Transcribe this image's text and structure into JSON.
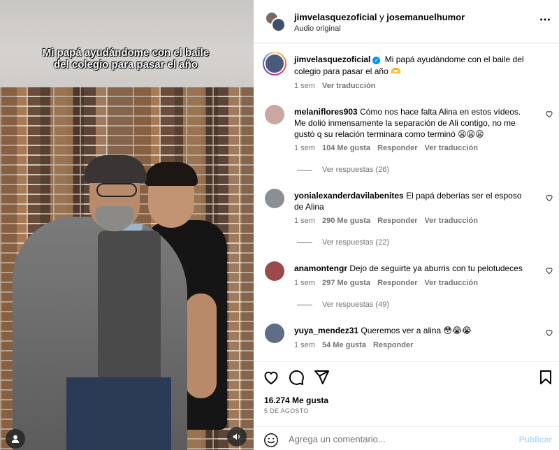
{
  "media": {
    "overlay_text": "Mi papá ayudándome con el baile del colegio para pasar el año",
    "user_icon": "person-icon",
    "volume_icon": "speaker-icon"
  },
  "header": {
    "user1": "jimvelasquezoficial",
    "connector": " y ",
    "user2": "josemanuelhumor",
    "audio": "Audio original",
    "more_icon": "more-horizontal-icon"
  },
  "caption": {
    "username": "jimvelasquezoficial",
    "text": "Mi papá ayudándome con el baile del colegio para pasar el año 🫶",
    "time": "1 sem",
    "translate": "Ver traducción"
  },
  "comments": [
    {
      "username": "melaniflores903",
      "text": "Cómo nos hace falta Alina en estos vídeos. Me dolió inmensamente la separación de Ali contigo, no me gustó q su relación terminara como terminó 😦😦😦",
      "time": "1 sem",
      "likes": "104 Me gusta",
      "reply": "Responder",
      "translate": "Ver traducción",
      "replies": "Ver respuestas (26)"
    },
    {
      "username": "yonialexanderdavilabenites",
      "text": "El papá deberías ser el esposo de Alina",
      "time": "1 sem",
      "likes": "290 Me gusta",
      "reply": "Responder",
      "translate": "Ver traducción",
      "replies": "Ver respuestas (22)"
    },
    {
      "username": "anamontengr",
      "text": "Dejo de seguirte ya aburris con tu pelotudeces",
      "time": "1 sem",
      "likes": "297 Me gusta",
      "reply": "Responder",
      "translate": "Ver traducción",
      "replies": "Ver respuestas (49)"
    },
    {
      "username": "yuya_mendez31",
      "text": "Queremos ver a alina 😳😭😭",
      "time": "1 sem",
      "likes": "54 Me gusta",
      "reply": "Responder"
    }
  ],
  "footer": {
    "likes": "16.274 Me gusta",
    "date": "5 DE AGOSTO",
    "comment_placeholder": "Agrega un comentario...",
    "post": "Publicar"
  },
  "colors": {
    "accent": "#0095f6",
    "muted": "#737373",
    "post_disabled": "#b3dbff"
  }
}
